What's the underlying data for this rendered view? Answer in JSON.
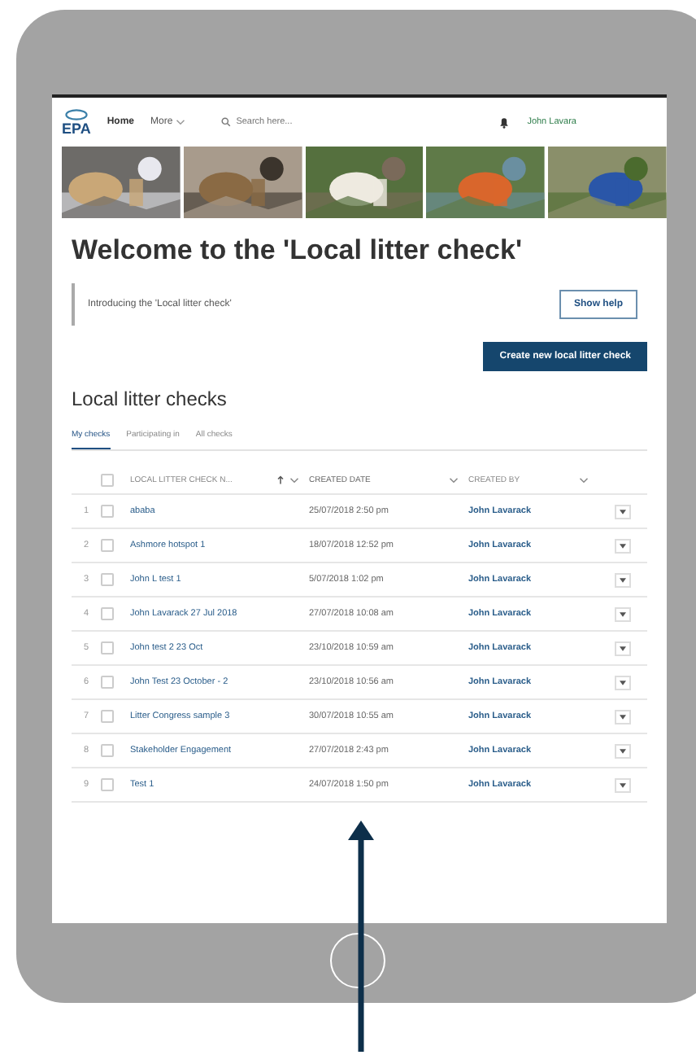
{
  "nav": {
    "logo": "EPA",
    "items": [
      {
        "label": "Home",
        "selected": true
      },
      {
        "label": "More",
        "selected": false
      }
    ],
    "search": {
      "placeholder": "Search here..."
    },
    "user": "John Lavara"
  },
  "title": "Welcome to the 'Local litter check'",
  "intro": {
    "text": "Introducing the 'Local litter check'",
    "button": "Show help"
  },
  "create_button": "Create new local litter check",
  "section_title": "Local litter checks",
  "tabs": [
    {
      "label": "My checks",
      "selected": true
    },
    {
      "label": "Participating in",
      "selected": false
    },
    {
      "label": "All checks",
      "selected": false
    }
  ],
  "table": {
    "select_all": {
      "checked": false
    },
    "columns": [
      "LOCAL LITTER CHECK N...",
      "CREATED DATE",
      "CREATED BY"
    ],
    "rows": [
      {
        "num": "1",
        "name": "ababa",
        "checked": false,
        "date": "25/07/2018 2:50 pm",
        "by": "John Lavarack"
      },
      {
        "num": "2",
        "name": "Ashmore hotspot 1",
        "checked": false,
        "date": "18/07/2018 12:52 pm",
        "by": "John Lavarack"
      },
      {
        "num": "3",
        "name": "John L test 1",
        "checked": false,
        "date": "5/07/2018 1:02 pm",
        "by": "John Lavarack"
      },
      {
        "num": "4",
        "name": "John Lavarack 27 Jul 2018",
        "checked": false,
        "date": "27/07/2018 10:08 am",
        "by": "John Lavarack"
      },
      {
        "num": "5",
        "name": "John test 2 23 Oct",
        "checked": false,
        "date": "23/10/2018 10:59 am",
        "by": "John Lavarack"
      },
      {
        "num": "6",
        "name": "John Test 23 October - 2",
        "checked": false,
        "date": "23/10/2018 10:56 am",
        "by": "John Lavarack"
      },
      {
        "num": "7",
        "name": "Litter Congress sample 3",
        "checked": false,
        "date": "30/07/2018 10:55 am",
        "by": "John Lavarack"
      },
      {
        "num": "8",
        "name": "Stakeholder Engagement",
        "checked": false,
        "date": "27/07/2018 2:43 pm",
        "by": "John Lavarack"
      },
      {
        "num": "9",
        "name": "Test 1",
        "checked": false,
        "date": "24/07/2018 1:50 pm",
        "by": "John Lavarack"
      }
    ]
  }
}
